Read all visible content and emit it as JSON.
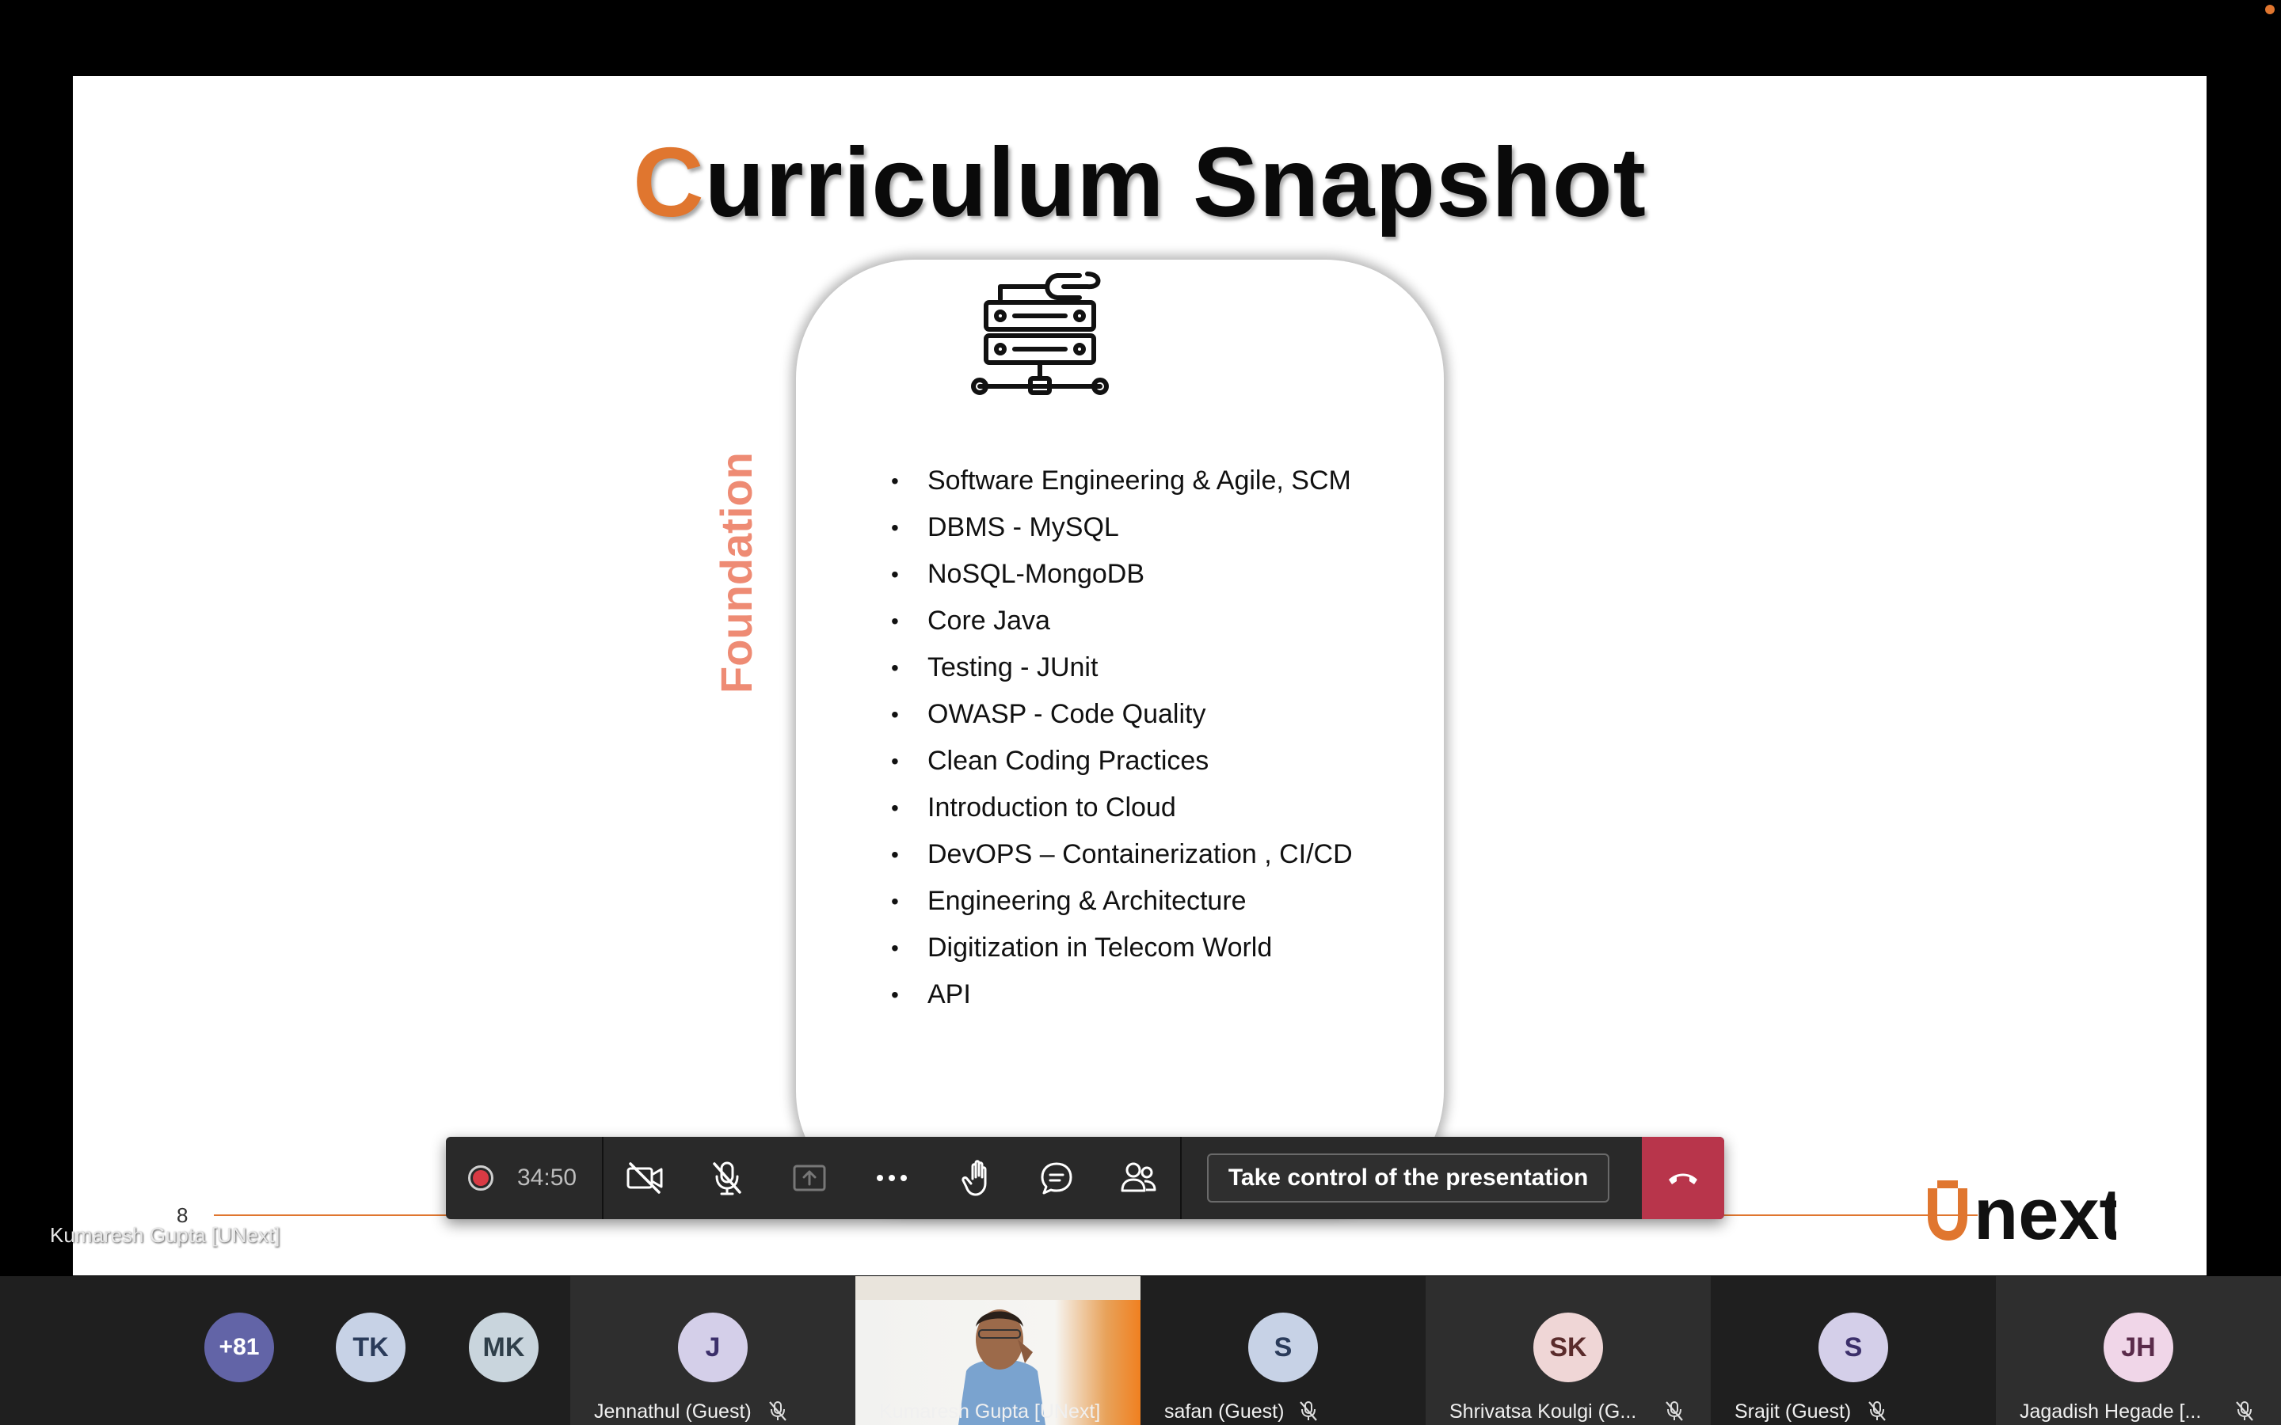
{
  "slide": {
    "title_first_letter": "C",
    "title_rest": "urriculum Snapshot",
    "vertical_label": "Foundation",
    "courses": [
      "Software Engineering & Agile, SCM",
      "DBMS - MySQL",
      "NoSQL-MongoDB",
      "Core Java",
      "Testing - JUnit",
      "OWASP - Code Quality",
      "Clean Coding Practices",
      "Introduction to Cloud",
      "DevOPS – Containerization , CI/CD",
      "Engineering & Architecture",
      "Digitization in Telecom World",
      "API"
    ],
    "page_number": "8",
    "logo_text": "Unext",
    "icon": "server-wrench-icon",
    "accent_color": "#e0762f"
  },
  "presenter_tag": "Kumaresh Gupta [UNext]",
  "toolbar": {
    "timer": "34:50",
    "take_control_label": "Take control of the presentation",
    "icons": [
      "recording-icon",
      "camera-off-icon",
      "mic-off-icon",
      "share-screen-icon",
      "more-icon",
      "raise-hand-icon",
      "chat-icon",
      "participants-icon",
      "hang-up-icon"
    ],
    "hangup_color": "#b8354b"
  },
  "participants": {
    "overflow_count": "+81",
    "avatars": [
      {
        "initials": "TK"
      },
      {
        "initials": "MK"
      },
      {
        "initials": "J",
        "name": "Jennathul (Guest)"
      },
      {
        "name": "Kumaresh Gupta [UNext]"
      },
      {
        "initials": "S",
        "name": "safan (Guest)"
      },
      {
        "initials": "SK",
        "name": "Shrivatsa Koulgi (G..."
      },
      {
        "initials": "S",
        "name": "Srajit (Guest)"
      },
      {
        "initials": "JH",
        "name": "Jagadish Hegade [..."
      }
    ]
  }
}
